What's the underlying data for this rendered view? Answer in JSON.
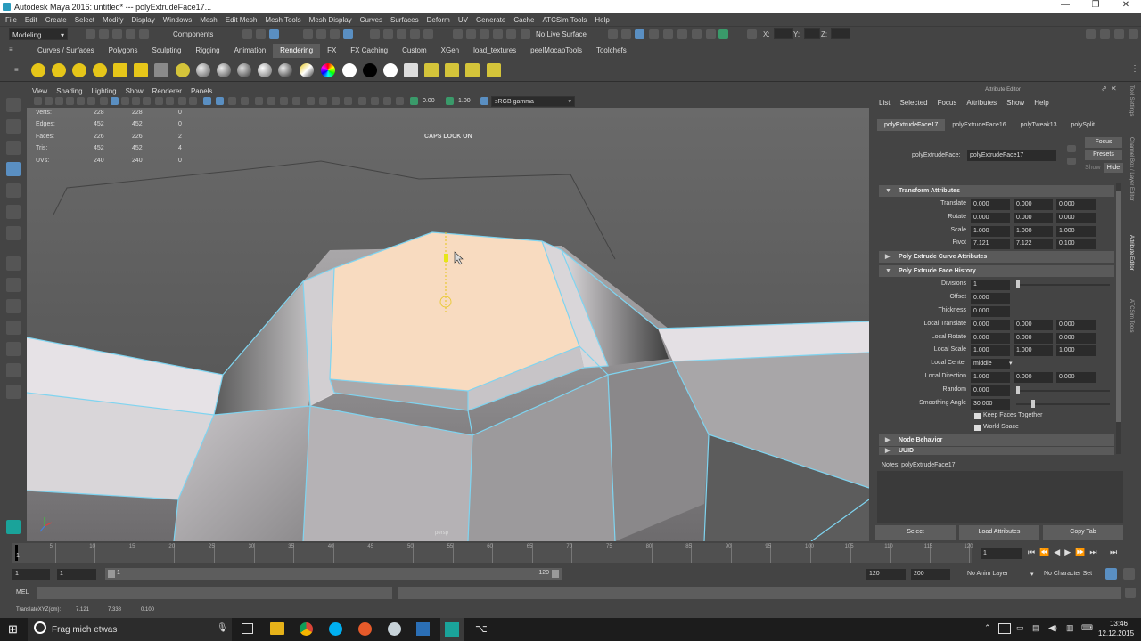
{
  "window": {
    "title": "Autodesk Maya 2016: untitled*   ---   polyExtrudeFace17..."
  },
  "menus": [
    "File",
    "Edit",
    "Create",
    "Select",
    "Modify",
    "Display",
    "Windows",
    "Mesh",
    "Edit Mesh",
    "Mesh Tools",
    "Mesh Display",
    "Curves",
    "Surfaces",
    "Deform",
    "UV",
    "Generate",
    "Cache",
    "ATCSim Tools",
    "Help"
  ],
  "status": {
    "mode": "Modeling",
    "components": "Components",
    "live": "No Live Surface",
    "x": "X:",
    "y": "Y:",
    "z": "Z:"
  },
  "shelf_tabs": [
    {
      "label": "Curves / Surfaces",
      "active": false
    },
    {
      "label": "Polygons",
      "active": false
    },
    {
      "label": "Sculpting",
      "active": false
    },
    {
      "label": "Rigging",
      "active": false
    },
    {
      "label": "Animation",
      "active": false
    },
    {
      "label": "Rendering",
      "active": true
    },
    {
      "label": "FX",
      "active": false
    },
    {
      "label": "FX Caching",
      "active": false
    },
    {
      "label": "Custom",
      "active": false
    },
    {
      "label": "XGen",
      "active": false
    },
    {
      "label": "load_textures",
      "active": false
    },
    {
      "label": "peelMocapTools",
      "active": false
    },
    {
      "label": "Toolchefs",
      "active": false
    }
  ],
  "viewport": {
    "menus": [
      "View",
      "Shading",
      "Lighting",
      "Show",
      "Renderer",
      "Panels"
    ],
    "exposure": "0.00",
    "gamma": "1.00",
    "colorspace": "sRGB gamma",
    "caps": "CAPS LOCK ON",
    "camera": "persp",
    "stats": [
      {
        "label": "Verts:",
        "a": "228",
        "b": "228",
        "c": "0"
      },
      {
        "label": "Edges:",
        "a": "452",
        "b": "452",
        "c": "0"
      },
      {
        "label": "Faces:",
        "a": "226",
        "b": "226",
        "c": "2"
      },
      {
        "label": "Tris:",
        "a": "452",
        "b": "452",
        "c": "4"
      },
      {
        "label": "UVs:",
        "a": "240",
        "b": "240",
        "c": "0"
      }
    ]
  },
  "attr": {
    "header": "Attribute Editor",
    "menus": [
      "List",
      "Selected",
      "Focus",
      "Attributes",
      "Show",
      "Help"
    ],
    "tabs": [
      "polyExtrudeFace17",
      "polyExtrudeFace16",
      "polyTweak13",
      "polySplit"
    ],
    "node_label": "polyExtrudeFace:",
    "node_value": "polyExtrudeFace17",
    "focus": "Focus",
    "presets": "Presets",
    "show": "Show",
    "hide": "Hide",
    "sections": {
      "transform": "Transform Attributes",
      "curve": "Poly Extrude Curve Attributes",
      "history": "Poly Extrude Face History",
      "node": "Node Behavior",
      "uuid": "UUID"
    },
    "transform": [
      {
        "label": "Translate",
        "v": [
          "0.000",
          "0.000",
          "0.000"
        ]
      },
      {
        "label": "Rotate",
        "v": [
          "0.000",
          "0.000",
          "0.000"
        ]
      },
      {
        "label": "Scale",
        "v": [
          "1.000",
          "1.000",
          "1.000"
        ]
      },
      {
        "label": "Pivot",
        "v": [
          "7.121",
          "7.122",
          "0.100"
        ]
      }
    ],
    "history": {
      "divisions": {
        "label": "Divisions",
        "v": "1"
      },
      "offset": {
        "label": "Offset",
        "v": "0.000"
      },
      "thickness": {
        "label": "Thickness",
        "v": "0.000"
      },
      "ltrans": {
        "label": "Local Translate",
        "v": [
          "0.000",
          "0.000",
          "0.000"
        ]
      },
      "lrot": {
        "label": "Local Rotate",
        "v": [
          "0.000",
          "0.000",
          "0.000"
        ]
      },
      "lscale": {
        "label": "Local Scale",
        "v": [
          "1.000",
          "1.000",
          "1.000"
        ]
      },
      "lcenter": {
        "label": "Local Center",
        "v": "middle"
      },
      "ldir": {
        "label": "Local Direction",
        "v": [
          "1.000",
          "0.000",
          "0.000"
        ]
      },
      "random": {
        "label": "Random",
        "v": "0.000"
      },
      "smooth": {
        "label": "Smoothing Angle",
        "v": "30.000"
      },
      "keep": "Keep Faces Together",
      "world": "World Space"
    },
    "notes": "Notes: polyExtrudeFace17",
    "buttons": [
      "Select",
      "Load Attributes",
      "Copy Tab"
    ],
    "sidetabs": [
      "Tool Settings",
      "Channel Box / Layer Editor",
      "Attribute Editor",
      "ATCSim Tools"
    ]
  },
  "timeline": {
    "ticks": [
      "5",
      "10",
      "15",
      "20",
      "25",
      "30",
      "35",
      "40",
      "45",
      "50",
      "55",
      "60",
      "65",
      "70",
      "75",
      "80",
      "85",
      "90",
      "95",
      "100",
      "105",
      "110",
      "115",
      "120"
    ],
    "first": "1",
    "current": "1"
  },
  "range": {
    "start": "1",
    "start2": "1",
    "slider_start": "1",
    "slider_end": "120",
    "end": "120",
    "end2": "200",
    "anim_layer": "No Anim Layer",
    "char_set": "No Character Set"
  },
  "mel": {
    "label": "MEL"
  },
  "help": {
    "label": "TranslateXYZ(cm):",
    "x": "7.121",
    "y": "7.338",
    "z": "0.100"
  },
  "taskbar": {
    "search": "Frag mich etwas",
    "time": "13:46",
    "date": "12.12.2015"
  }
}
